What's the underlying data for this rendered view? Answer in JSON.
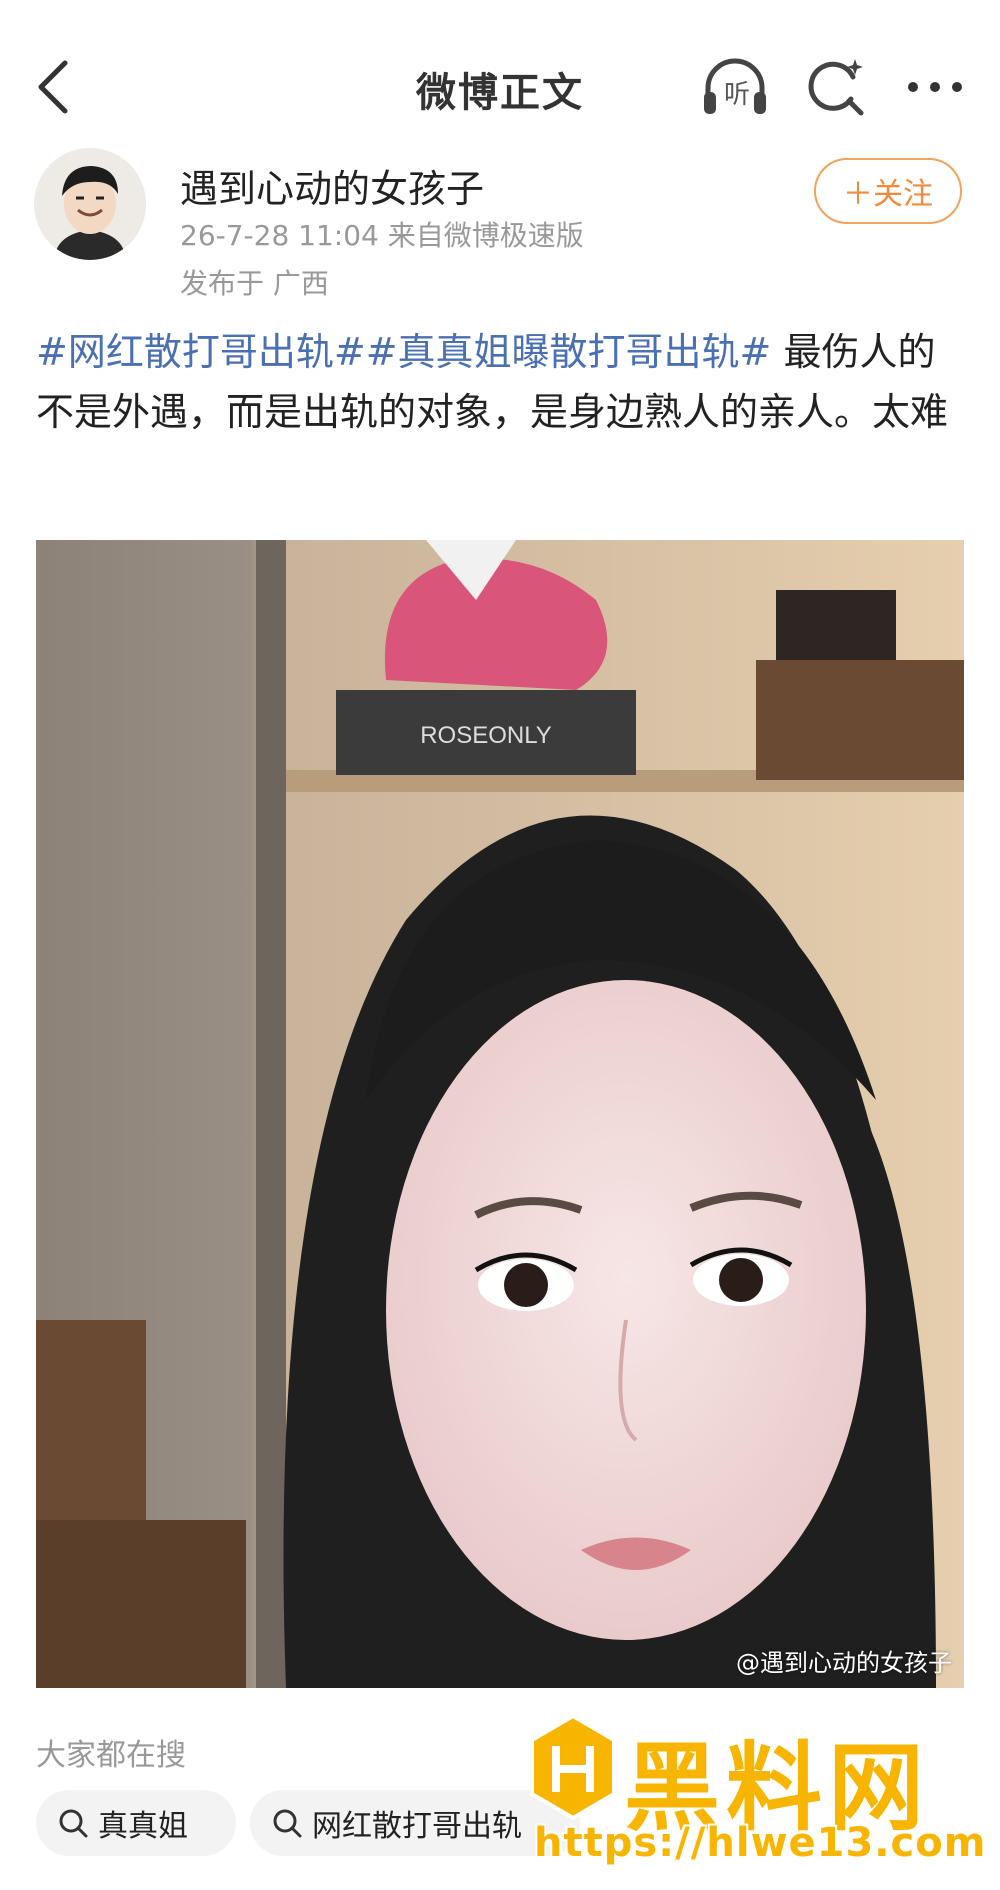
{
  "header": {
    "title": "微博正文",
    "listen_label": "听"
  },
  "user": {
    "name": "遇到心动的女孩子",
    "time_source": "26-7-28 11:04  来自微博极速版",
    "location": "发布于 广西",
    "follow_label": "＋关注"
  },
  "post": {
    "tag1": "#网红散打哥出轨#",
    "tag2": "#真真姐曝散打哥出轨#",
    "text": " 最伤人的不是外遇，而是出轨的对象，是身边熟人的亲人。太难"
  },
  "image": {
    "box_label": "ROSEONLY",
    "watermark": "@遇到心动的女孩子"
  },
  "search": {
    "heading": "大家都在搜",
    "chips": [
      "真真姐",
      "网红散打哥出轨"
    ]
  },
  "overlay": {
    "logo_text": "黑料网",
    "url": "https://hlwe13.com"
  },
  "colors": {
    "tag": "#4b6fb3",
    "follow": "#f08a3c",
    "logo": "#f7b500"
  }
}
